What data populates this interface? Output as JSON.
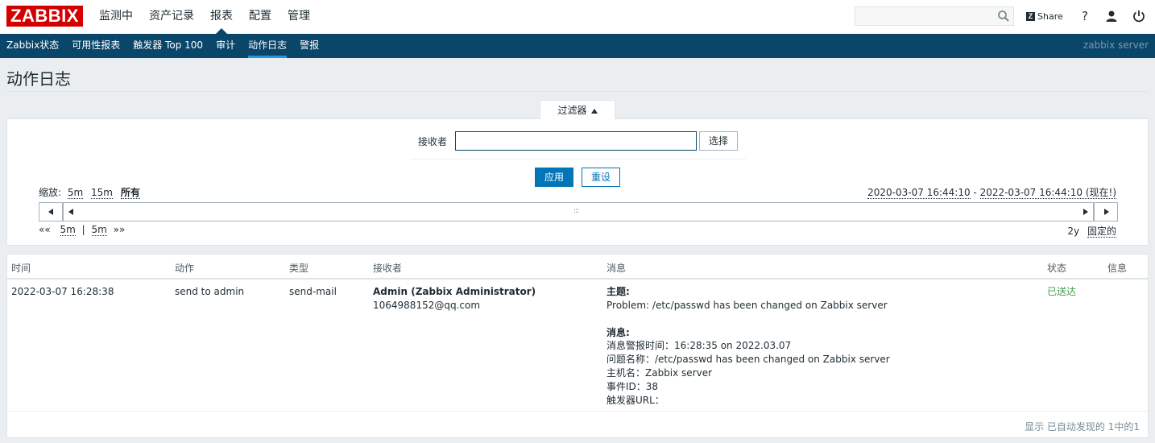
{
  "header": {
    "logo": "ZABBIX",
    "nav": [
      {
        "label": "监测中"
      },
      {
        "label": "资产记录"
      },
      {
        "label": "报表",
        "active": true
      },
      {
        "label": "配置"
      },
      {
        "label": "管理"
      }
    ],
    "search_value": "",
    "share_label": "Share",
    "help_label": "?"
  },
  "subnav": {
    "items": [
      {
        "label": "Zabbix状态"
      },
      {
        "label": "可用性报表"
      },
      {
        "label": "触发器 Top 100"
      },
      {
        "label": "审计"
      },
      {
        "label": "动作日志",
        "active": true
      },
      {
        "label": "警报"
      }
    ],
    "server": "zabbix server"
  },
  "page": {
    "title": "动作日志"
  },
  "filter": {
    "tab_label": "过滤器",
    "recipient_label": "接收者",
    "recipient_value": "",
    "select_label": "选择",
    "apply_label": "应用",
    "reset_label": "重设",
    "zoom_label": "缩放:",
    "zoom_options": [
      "5m",
      "15m",
      "所有"
    ],
    "range_from": "2020-03-07 16:44:10",
    "range_sep": " - ",
    "range_to": "2022-03-07 16:44:10 (现在!)",
    "step_back": "««",
    "step_left": "5m",
    "step_sep": "|",
    "step_right": "5m",
    "step_fwd": "»»",
    "period": "2y",
    "fixed_label": "固定的"
  },
  "table": {
    "headers": [
      "时间",
      "动作",
      "类型",
      "接收者",
      "消息",
      "状态",
      "信息"
    ],
    "rows": [
      {
        "time": "2022-03-07 16:28:38",
        "action": "send to admin",
        "type": "send-mail",
        "recipient_name": "Admin (Zabbix Administrator)",
        "recipient_email": "1064988152@qq.com",
        "subject_label": "主题:",
        "subject": "Problem: /etc/passwd has been changed on Zabbix server",
        "message_label": "消息:",
        "message_lines": [
          "消息警报时间：16:28:35 on 2022.03.07",
          "问题名称：/etc/passwd has been changed on Zabbix server",
          "主机名：Zabbix server",
          "事件ID：38",
          "触发器URL："
        ],
        "status": "已送达",
        "info": ""
      }
    ],
    "footer": "显示 已自动发现的 1中的1"
  },
  "colors": {
    "brand": "#d40000",
    "nav_bg": "#0a466a",
    "accent": "#0275b8",
    "status_ok": "#429e47"
  }
}
